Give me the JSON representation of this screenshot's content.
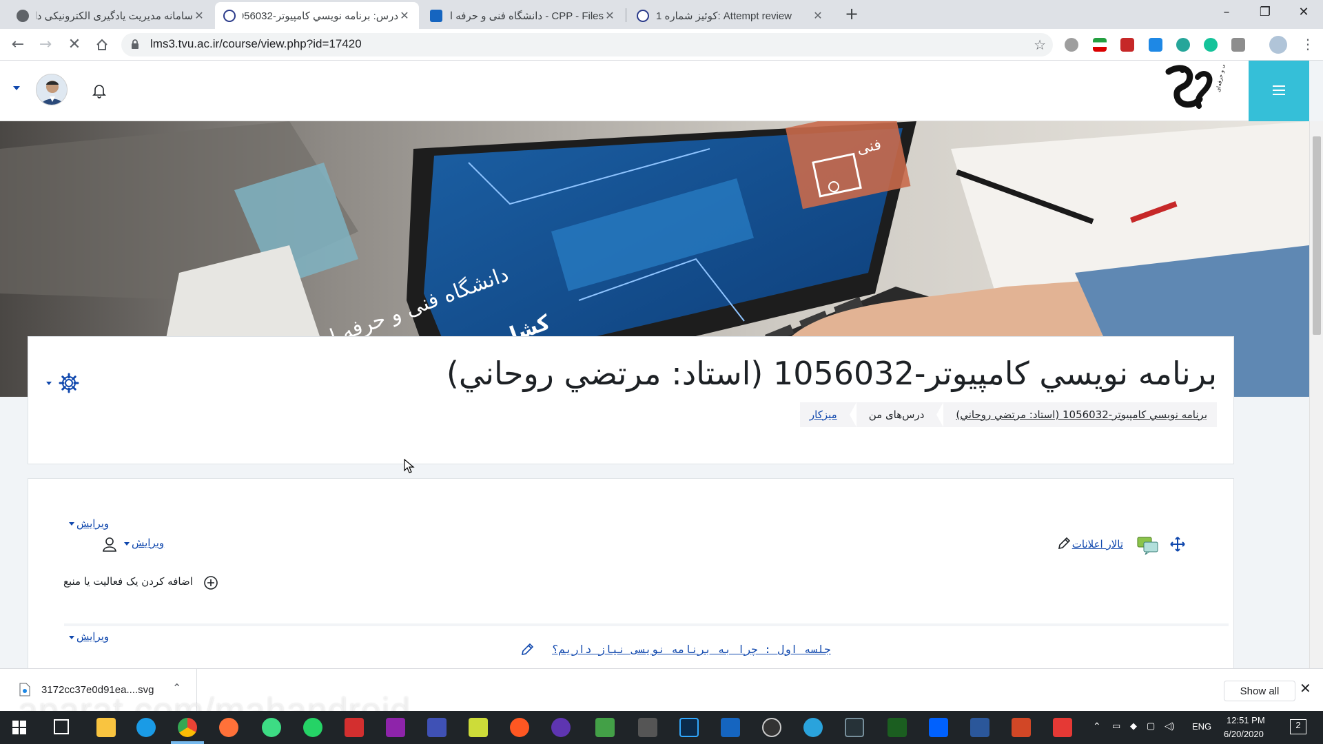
{
  "browser": {
    "tabs": [
      {
        "title": "سامانه مدیریت یادگیری الکترونیکی دا",
        "active": false
      },
      {
        "title": "درس: برنامه نويسي كامپيوتر-1056032",
        "active": true
      },
      {
        "title": "CPP - Files - دانشگاه فنی و حرفه ای",
        "active": false
      },
      {
        "title": "Attempt review :کوئیز شماره 1",
        "active": false
      }
    ],
    "new_tab": "+",
    "close": "✕",
    "url": "lms3.tvu.ac.ir/course/view.php?id=17420"
  },
  "site": {
    "course_title": "برنامه نويسي كامپيوتر-1056032 (استاد: مرتضي روحاني)",
    "breadcrumb": {
      "dashboard": "میزکار",
      "my_courses": "درس‌های من",
      "current": "برنامه نويسي كامپيوتر-1056032 (استاد: مرتضي روحاني)"
    },
    "banner_text": {
      "line1": "دانشگاه فنی و حرفه ای",
      "line2": "کشاورزی و دامپزشکی",
      "corner": "فنی"
    },
    "logo_caption": "دانشگاه فنی و حرفه‌ای"
  },
  "content": {
    "edit_label": "ویرایش",
    "forum_link": "تالار اعلانات",
    "add_activity": "اضافه کردن یک فعالیت یا منبع",
    "session_link": "جلسه اول : چرا به برنامه نویسی نیاز داریم؟"
  },
  "downloads": {
    "file_name": "3172cc37e0d91ea....svg",
    "show_all": "Show all"
  },
  "watermark": "aparat.com/mahandroid",
  "taskbar": {
    "language": "ENG",
    "time": "12:51 PM",
    "date": "6/20/2020",
    "notifications": "2"
  },
  "colors": {
    "accent": "#35bfd8",
    "link": "#0f47ad",
    "text": "#1d2125"
  },
  "icons": [
    "back-icon",
    "forward-icon",
    "stop-icon",
    "home-icon",
    "lock-icon",
    "star-icon",
    "bell-icon",
    "gear-icon",
    "pencil-icon",
    "move-icon",
    "forum-icon",
    "add-icon",
    "user-icon"
  ]
}
